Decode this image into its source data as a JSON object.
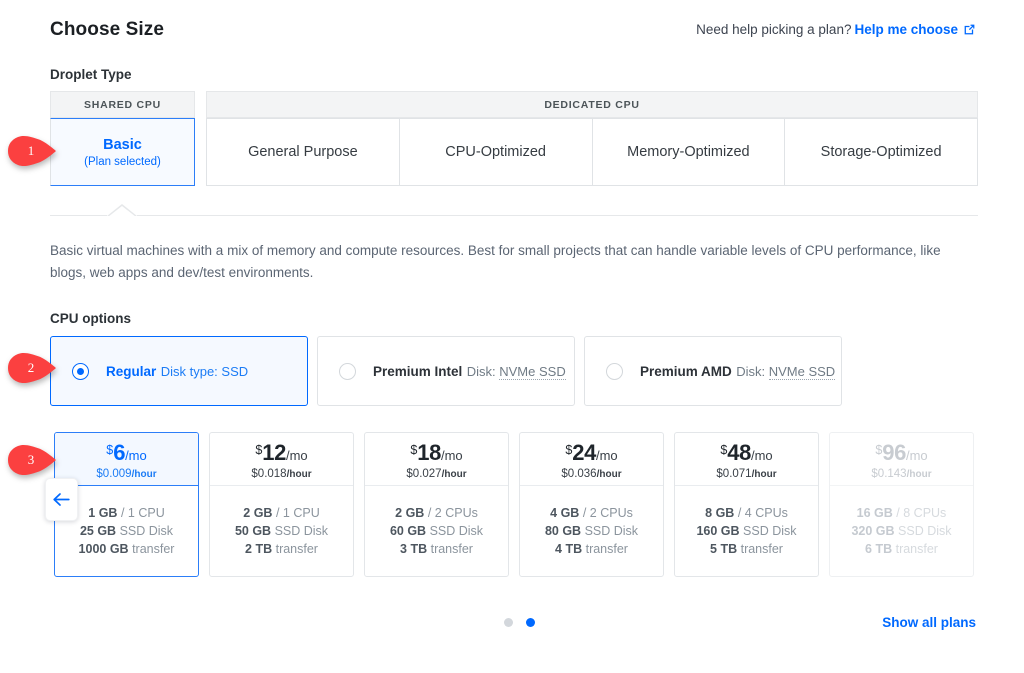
{
  "header": {
    "title": "Choose Size",
    "help_question": "Need help picking a plan?",
    "help_link": "Help me choose",
    "external_link_icon": "external-link-icon"
  },
  "droplet_type": {
    "label": "Droplet Type",
    "groups": [
      {
        "header": "SHARED CPU",
        "tabs": [
          {
            "label": "Basic",
            "sub": "(Plan selected)",
            "selected": true
          }
        ]
      },
      {
        "header": "DEDICATED CPU",
        "tabs": [
          {
            "label": "General Purpose",
            "sub": "",
            "selected": false
          },
          {
            "label": "CPU-Optimized",
            "sub": "",
            "selected": false
          },
          {
            "label": "Memory-Optimized",
            "sub": "",
            "selected": false
          },
          {
            "label": "Storage-Optimized",
            "sub": "",
            "selected": false
          }
        ]
      }
    ],
    "description": "Basic virtual machines with a mix of memory and compute resources. Best for small projects that can handle variable levels of CPU performance, like blogs, web apps and dev/test environments."
  },
  "cpu_options": {
    "label": "CPU options",
    "items": [
      {
        "name": "Regular",
        "disk_prefix": "Disk type:",
        "disk_value": "SSD",
        "selected": true,
        "dotted": false
      },
      {
        "name": "Premium Intel",
        "disk_prefix": "Disk:",
        "disk_value": "NVMe SSD",
        "selected": false,
        "dotted": true
      },
      {
        "name": "Premium AMD",
        "disk_prefix": "Disk:",
        "disk_value": "NVMe SSD",
        "selected": false,
        "dotted": true
      }
    ]
  },
  "plans": [
    {
      "currency": "$",
      "amount": "6",
      "per": "/mo",
      "hourly_price": "$0.009",
      "hourly_unit": "/hour",
      "memory": "1 GB",
      "cpu": "/ 1 CPU",
      "disk": "25 GB",
      "disk_label": "SSD Disk",
      "transfer": "1000 GB",
      "transfer_label": "transfer",
      "selected": true,
      "faded": false
    },
    {
      "currency": "$",
      "amount": "12",
      "per": "/mo",
      "hourly_price": "$0.018",
      "hourly_unit": "/hour",
      "memory": "2 GB",
      "cpu": "/ 1 CPU",
      "disk": "50 GB",
      "disk_label": "SSD Disk",
      "transfer": "2 TB",
      "transfer_label": "transfer",
      "selected": false,
      "faded": false
    },
    {
      "currency": "$",
      "amount": "18",
      "per": "/mo",
      "hourly_price": "$0.027",
      "hourly_unit": "/hour",
      "memory": "2 GB",
      "cpu": "/ 2 CPUs",
      "disk": "60 GB",
      "disk_label": "SSD Disk",
      "transfer": "3 TB",
      "transfer_label": "transfer",
      "selected": false,
      "faded": false
    },
    {
      "currency": "$",
      "amount": "24",
      "per": "/mo",
      "hourly_price": "$0.036",
      "hourly_unit": "/hour",
      "memory": "4 GB",
      "cpu": "/ 2 CPUs",
      "disk": "80 GB",
      "disk_label": "SSD Disk",
      "transfer": "4 TB",
      "transfer_label": "transfer",
      "selected": false,
      "faded": false
    },
    {
      "currency": "$",
      "amount": "48",
      "per": "/mo",
      "hourly_price": "$0.071",
      "hourly_unit": "/hour",
      "memory": "8 GB",
      "cpu": "/ 4 CPUs",
      "disk": "160 GB",
      "disk_label": "SSD Disk",
      "transfer": "5 TB",
      "transfer_label": "transfer",
      "selected": false,
      "faded": false
    },
    {
      "currency": "$",
      "amount": "96",
      "per": "/mo",
      "hourly_price": "$0.143",
      "hourly_unit": "/hour",
      "memory": "16 GB",
      "cpu": "/ 8 CPUs",
      "disk": "320 GB",
      "disk_label": "SSD Disk",
      "transfer": "6 TB",
      "transfer_label": "transfer",
      "selected": false,
      "faded": true
    }
  ],
  "carousel": {
    "prev_icon": "arrow-left-icon",
    "dots": [
      {
        "active": false
      },
      {
        "active": true
      }
    ]
  },
  "footer": {
    "show_all_plans": "Show all plans"
  },
  "annotations": [
    {
      "number": "1"
    },
    {
      "number": "2"
    },
    {
      "number": "3"
    }
  ],
  "colors": {
    "accent_blue": "#0069ff",
    "selected_bg": "#f5f9ff",
    "annotation_red": "#fb4040",
    "muted_text": "#8b949d"
  }
}
